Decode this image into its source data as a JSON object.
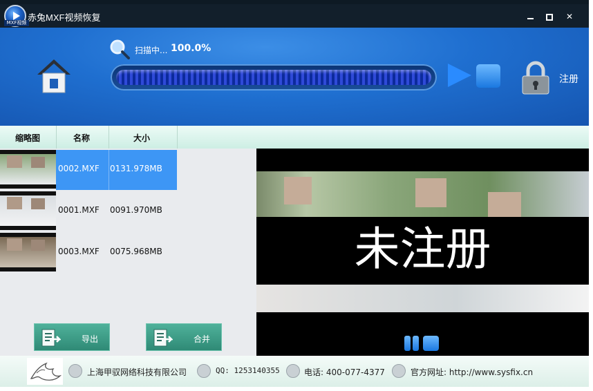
{
  "window": {
    "title": "赤兔MXF视频恢复",
    "logo_text": "MXF视频",
    "minimize": "",
    "maximize": "",
    "close": "✕"
  },
  "toolbar": {
    "scan_label": "扫描中...",
    "scan_percent": "100.0%",
    "progress": 1.0,
    "register": "注册"
  },
  "columns": {
    "thumbnail": "缩略图",
    "name": "名称",
    "size": "大小"
  },
  "files": [
    {
      "name": "0002.MXF",
      "size": "0131.978MB",
      "selected": true
    },
    {
      "name": "0001.MXF",
      "size": "0091.970MB",
      "selected": false
    },
    {
      "name": "0003.MXF",
      "size": "0075.968MB",
      "selected": false
    }
  ],
  "actions": {
    "export": "导出",
    "merge": "合并"
  },
  "preview": {
    "watermark": "未注册"
  },
  "footer": {
    "company": "上海甲驭网络科技有限公司",
    "qq": "QQ: 1253140355",
    "phone": "电话: 400-077-4377",
    "website": "官方网址: http://www.sysfix.cn"
  },
  "colors": {
    "toolbar_blue": "#1f6fd0",
    "selection": "#3d96f5",
    "button_green": "#3f9f88"
  }
}
